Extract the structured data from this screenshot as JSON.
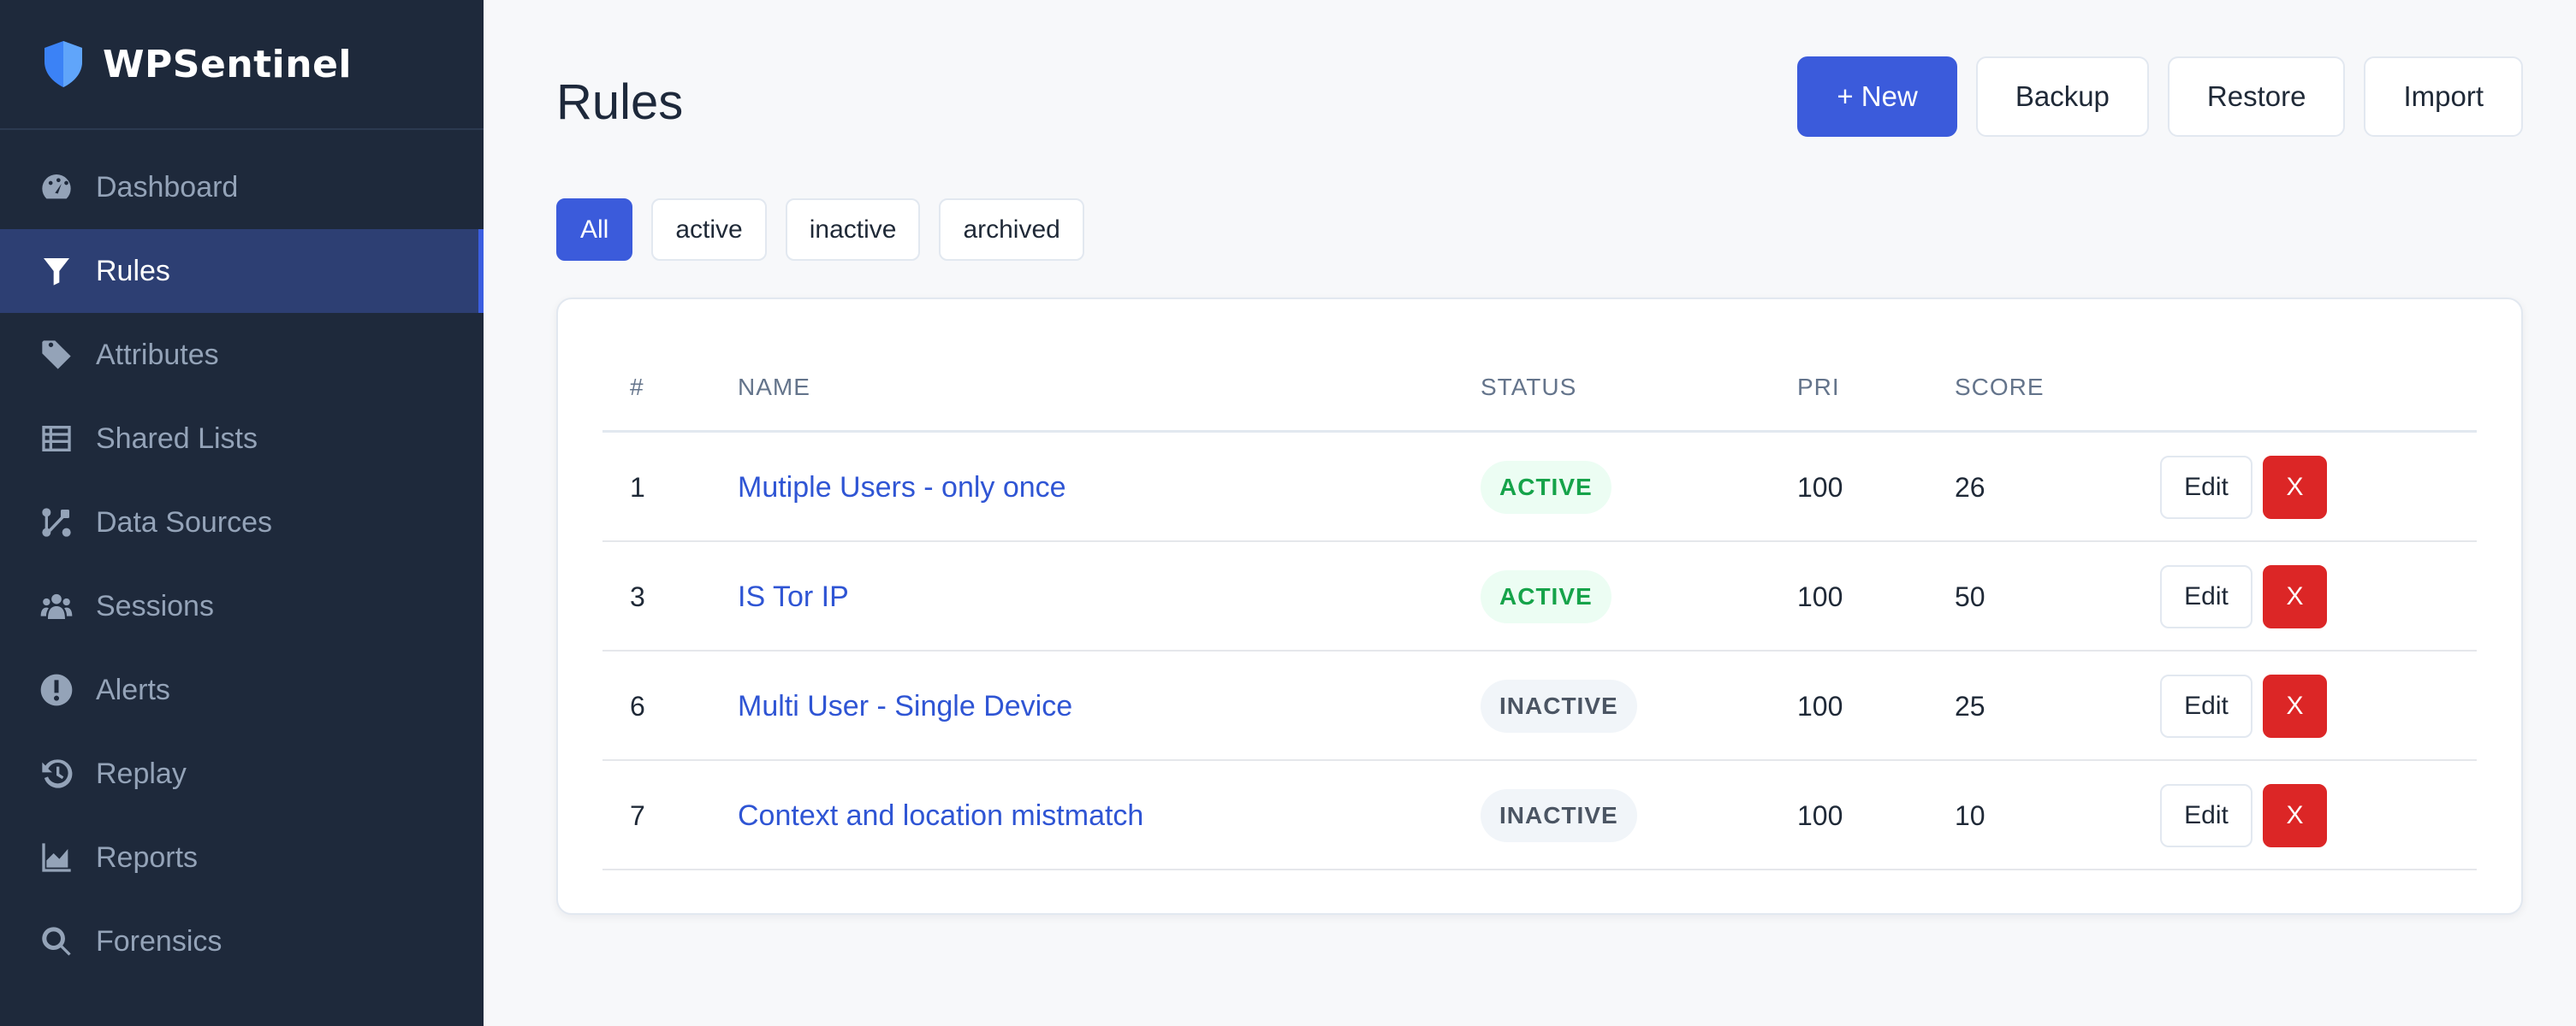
{
  "brand": {
    "name": "WPSentinel",
    "icon": "shield-icon"
  },
  "sidebar": {
    "items": [
      {
        "label": "Dashboard",
        "icon": "dashboard-gauge-icon",
        "active": false
      },
      {
        "label": "Rules",
        "icon": "filter-icon",
        "active": true
      },
      {
        "label": "Attributes",
        "icon": "tag-icon",
        "active": false
      },
      {
        "label": "Shared Lists",
        "icon": "table-list-icon",
        "active": false
      },
      {
        "label": "Data Sources",
        "icon": "bezier-nodes-icon",
        "active": false
      },
      {
        "label": "Sessions",
        "icon": "users-icon",
        "active": false
      },
      {
        "label": "Alerts",
        "icon": "exclamation-circle-icon",
        "active": false
      },
      {
        "label": "Replay",
        "icon": "history-icon",
        "active": false
      },
      {
        "label": "Reports",
        "icon": "chart-area-icon",
        "active": false
      },
      {
        "label": "Forensics",
        "icon": "search-icon",
        "active": false
      }
    ]
  },
  "page": {
    "title": "Rules"
  },
  "actions": {
    "new": "+ New",
    "backup": "Backup",
    "restore": "Restore",
    "import": "Import"
  },
  "filters": [
    {
      "label": "All",
      "selected": true
    },
    {
      "label": "active",
      "selected": false
    },
    {
      "label": "inactive",
      "selected": false
    },
    {
      "label": "archived",
      "selected": false
    }
  ],
  "table": {
    "headers": {
      "id": "#",
      "name": "NAME",
      "status": "STATUS",
      "pri": "PRI",
      "score": "SCORE"
    },
    "edit_label": "Edit",
    "delete_label": "X",
    "rows": [
      {
        "id": "1",
        "name": "Mutiple Users - only once",
        "status": "ACTIVE",
        "pri": "100",
        "score": "26"
      },
      {
        "id": "3",
        "name": "IS Tor IP",
        "status": "ACTIVE",
        "pri": "100",
        "score": "50"
      },
      {
        "id": "6",
        "name": "Multi User - Single Device",
        "status": "INACTIVE",
        "pri": "100",
        "score": "25"
      },
      {
        "id": "7",
        "name": "Context and location mistmatch",
        "status": "INACTIVE",
        "pri": "100",
        "score": "10"
      }
    ]
  },
  "colors": {
    "sidebar_bg": "#1e293b",
    "active_nav_bg": "#2d3f73",
    "primary": "#3b5bdb",
    "link": "#2f55d4",
    "status_active": "#16a34a",
    "status_inactive": "#4b5563",
    "danger": "#dc2626"
  }
}
